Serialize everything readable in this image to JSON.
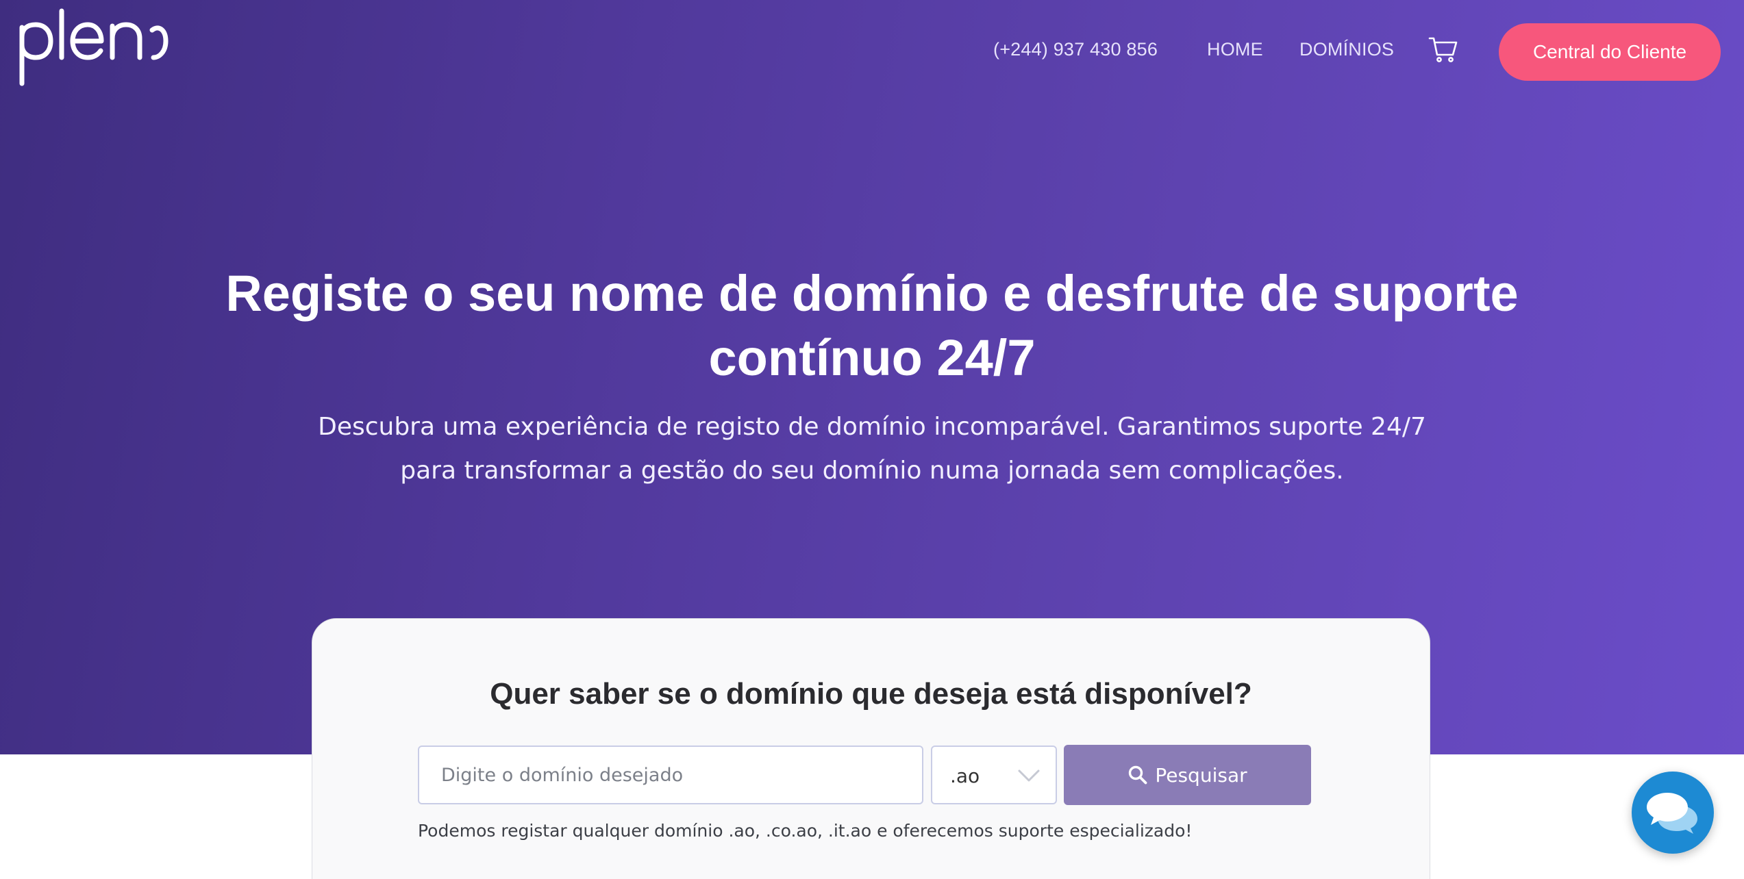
{
  "header": {
    "logo_alt": "pleno",
    "phone": "(+244) 937 430 856",
    "nav": {
      "home": "HOME",
      "domains": "DOMÍNIOS"
    },
    "cart_icon": "cart-icon",
    "client_button": "Central do Cliente"
  },
  "hero": {
    "title": "Registe o seu nome de domínio e desfrute de suporte contínuo 24/7",
    "subtitle": "Descubra uma experiência de registo de domínio incomparável. Garantimos suporte 24/7 para transformar a gestão do seu domínio numa jornada sem complicações."
  },
  "search": {
    "title": "Quer saber se o domínio que deseja está disponível?",
    "input_placeholder": "Digite o domínio desejado",
    "input_value": "",
    "tld_selected": ".ao",
    "button_label": "Pesquisar",
    "button_icon": "search-icon",
    "note": "Podemos registar qualquer domínio .ao, .co.ao, .it.ao e oferecemos suporte especializado!"
  },
  "chat": {
    "icon": "chat-icon"
  },
  "colors": {
    "hero_start": "#3f2d80",
    "hero_end": "#6b4dc9",
    "accent_pink": "#f7577c",
    "search_button": "#8a7cb6",
    "chat_blue": "#1d8ad3"
  }
}
